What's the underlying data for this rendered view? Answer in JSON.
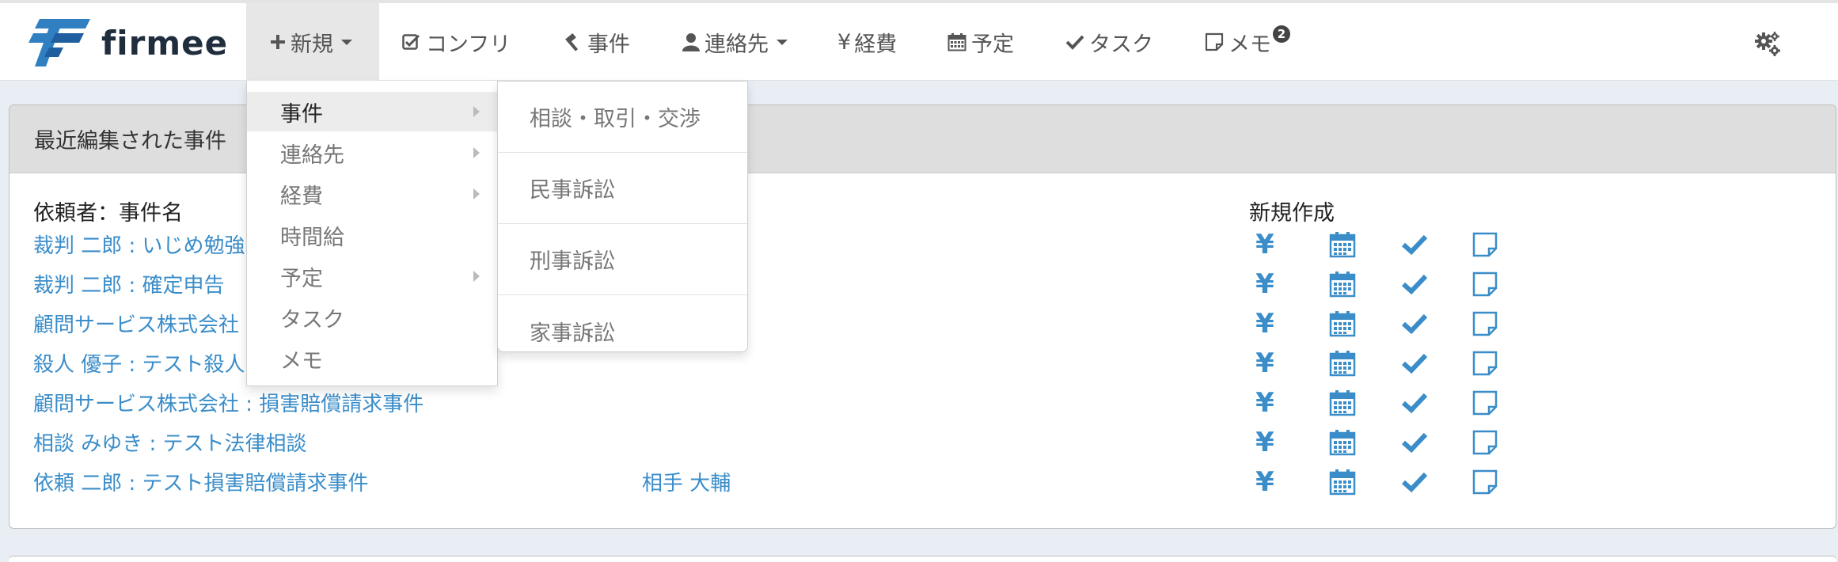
{
  "brand": {
    "name": "firmee"
  },
  "nav": {
    "new_label": "新規",
    "conflict_label": "コンフリ",
    "cases_label": "事件",
    "contacts_label": "連絡先",
    "expenses_label": "経費",
    "schedule_label": "予定",
    "tasks_label": "タスク",
    "memo_label": "メモ",
    "memo_badge": "2",
    "yen_symbol": "¥"
  },
  "new_menu": {
    "items": [
      {
        "label": "事件"
      },
      {
        "label": "連絡先"
      },
      {
        "label": "経費"
      },
      {
        "label": "時間給"
      },
      {
        "label": "予定"
      },
      {
        "label": "タスク"
      },
      {
        "label": "メモ"
      }
    ]
  },
  "case_submenu": {
    "items": [
      {
        "label": "相談・取引・交渉"
      },
      {
        "label": "民事訴訟"
      },
      {
        "label": "刑事訴訟"
      },
      {
        "label": "家事訴訟"
      }
    ]
  },
  "panel": {
    "title": "最近編集された事件",
    "col_client_case": "依頼者：事件名",
    "col_new": "新規作成",
    "yen_symbol": "¥",
    "rows": [
      {
        "case": "裁判 二郎 : いじめ勉強"
      },
      {
        "case": "裁判 二郎 : 確定申告"
      },
      {
        "case": "顧問サービス株式会社"
      },
      {
        "case": "殺人 優子 : テスト殺人"
      },
      {
        "case": "顧問サービス株式会社 : 損害賠償請求事件"
      },
      {
        "case": "相談 みゆき : テスト法律相談"
      },
      {
        "case": "依頼 二郎 : テスト損害賠償請求事件",
        "opponent": "相手 大輔"
      }
    ]
  },
  "colors": {
    "link": "#3a8dc9",
    "nav_text": "#555555",
    "brand_blue": "#2f7fc1",
    "brand_dark": "#1f2d3d",
    "active_bg": "#e7e7e7"
  }
}
